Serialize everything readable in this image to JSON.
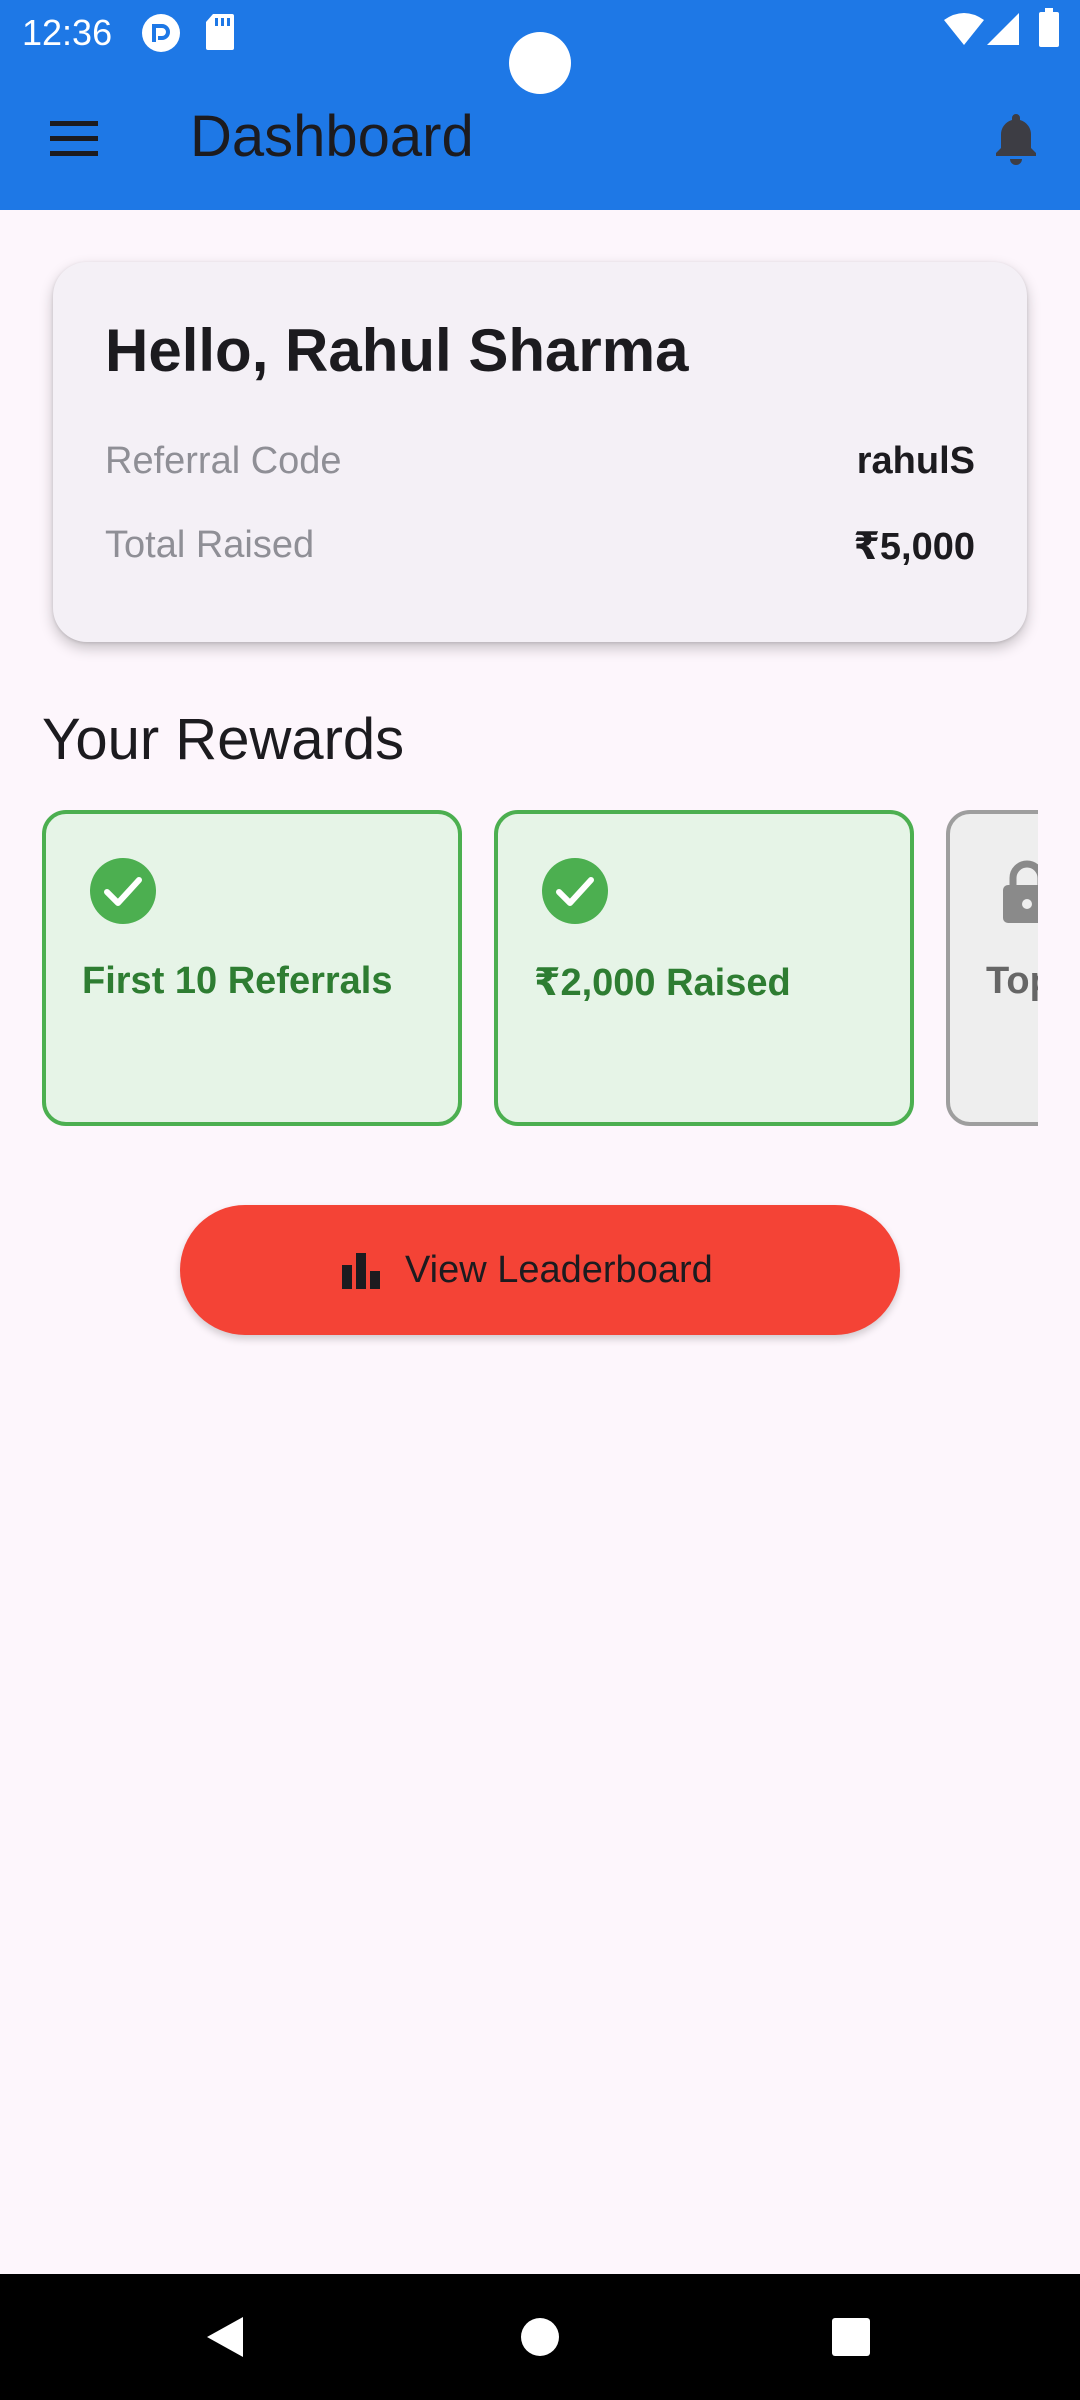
{
  "status_bar": {
    "time": "12:36",
    "left_icons": [
      "pocket-casts-icon",
      "sd-card-icon"
    ],
    "right_icons": [
      "wifi-icon",
      "cell-signal-icon",
      "battery-icon"
    ]
  },
  "app_bar": {
    "title": "Dashboard",
    "menu_icon": "hamburger-menu-icon",
    "notification_icon": "bell-icon"
  },
  "profile": {
    "greeting": "Hello, Rahul Sharma",
    "referral_code_label": "Referral Code",
    "referral_code_value": "rahulS",
    "total_raised_label": "Total Raised",
    "total_raised_value": "₹5,000"
  },
  "rewards": {
    "title": "Your Rewards",
    "items": [
      {
        "label": "First 10 Referrals",
        "status": "achieved",
        "icon": "check-circle-icon"
      },
      {
        "label": "₹2,000 Raised",
        "status": "achieved",
        "icon": "check-circle-icon"
      },
      {
        "label": "Top",
        "status": "locked",
        "icon": "lock-icon"
      }
    ]
  },
  "leaderboard_button": {
    "label": "View Leaderboard",
    "icon": "bar-chart-icon"
  },
  "colors": {
    "app_bar": "#1e78e6",
    "background": "#fdf6fc",
    "card": "#f4f0f6",
    "reward_achieved_border": "#4caf50",
    "reward_achieved_bg": "#e6f4e7",
    "reward_achieved_text": "#2e7d32",
    "reward_locked_border": "#9e9e9e",
    "reward_locked_bg": "#eeeeee",
    "button": "#f44336"
  },
  "nav_bar": {
    "buttons": [
      "back-icon",
      "home-icon",
      "recents-icon"
    ]
  }
}
